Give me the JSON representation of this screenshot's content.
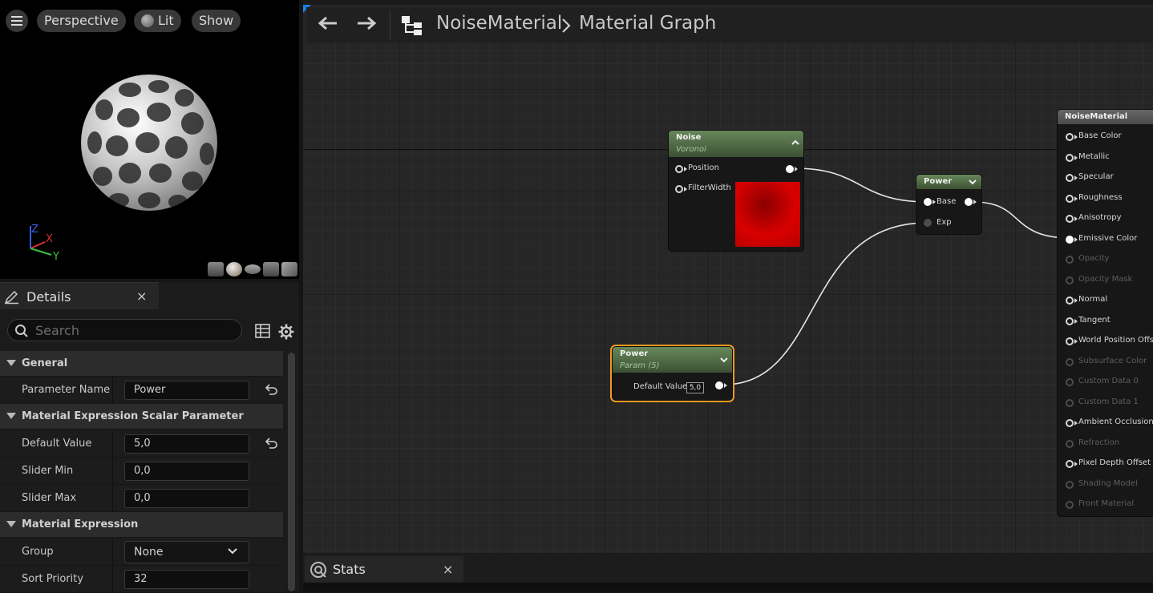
{
  "viewport": {
    "perspective_label": "Perspective",
    "lit_label": "Lit",
    "show_label": "Show",
    "axes": {
      "x": "X",
      "y": "Y",
      "z": "Z"
    }
  },
  "details": {
    "tab_title": "Details",
    "tab_close": "×",
    "search_placeholder": "Search",
    "categories": {
      "general": "General",
      "scalar": "Material Expression Scalar Parameter",
      "expression": "Material Expression"
    },
    "props": {
      "parameter_name": {
        "label": "Parameter Name",
        "value": "Power"
      },
      "default_value": {
        "label": "Default Value",
        "value": "5,0"
      },
      "slider_min": {
        "label": "Slider Min",
        "value": "0,0"
      },
      "slider_max": {
        "label": "Slider Max",
        "value": "0,0"
      },
      "group": {
        "label": "Group",
        "value": "None"
      },
      "sort_priority": {
        "label": "Sort Priority",
        "value": "32"
      }
    }
  },
  "graph": {
    "breadcrumb_root": "NoiseMaterial",
    "breadcrumb_page": "Material Graph",
    "nodes": {
      "noise": {
        "title": "Noise",
        "subtitle": "Voronoi",
        "pins": [
          "Position",
          "FilterWidth"
        ]
      },
      "power": {
        "title": "Power",
        "pins": [
          "Base",
          "Exp"
        ]
      },
      "power_param": {
        "title": "Power",
        "subtitle": "Param (5)",
        "pin": "Default Value",
        "value": "5,0"
      },
      "material": {
        "title": "NoiseMaterial",
        "pins": [
          {
            "label": "Base Color",
            "enabled": true
          },
          {
            "label": "Metallic",
            "enabled": true
          },
          {
            "label": "Specular",
            "enabled": true
          },
          {
            "label": "Roughness",
            "enabled": true
          },
          {
            "label": "Anisotropy",
            "enabled": true
          },
          {
            "label": "Emissive Color",
            "enabled": true
          },
          {
            "label": "Opacity",
            "enabled": false
          },
          {
            "label": "Opacity Mask",
            "enabled": false
          },
          {
            "label": "Normal",
            "enabled": true
          },
          {
            "label": "Tangent",
            "enabled": true
          },
          {
            "label": "World Position Offset",
            "enabled": true
          },
          {
            "label": "Subsurface Color",
            "enabled": false
          },
          {
            "label": "Custom Data 0",
            "enabled": false
          },
          {
            "label": "Custom Data 1",
            "enabled": false
          },
          {
            "label": "Ambient Occlusion",
            "enabled": true
          },
          {
            "label": "Refraction",
            "enabled": false
          },
          {
            "label": "Pixel Depth Offset",
            "enabled": true
          },
          {
            "label": "Shading Model",
            "enabled": false
          },
          {
            "label": "Front Material",
            "enabled": false
          }
        ]
      }
    }
  },
  "stats": {
    "tab_title": "Stats",
    "tab_close": "×"
  },
  "colors": {
    "accent_blue": "#1a7fe0",
    "selection_orange": "#f29a22",
    "node_header_green": "#67885a",
    "noise_preview_red": "#c80000"
  }
}
